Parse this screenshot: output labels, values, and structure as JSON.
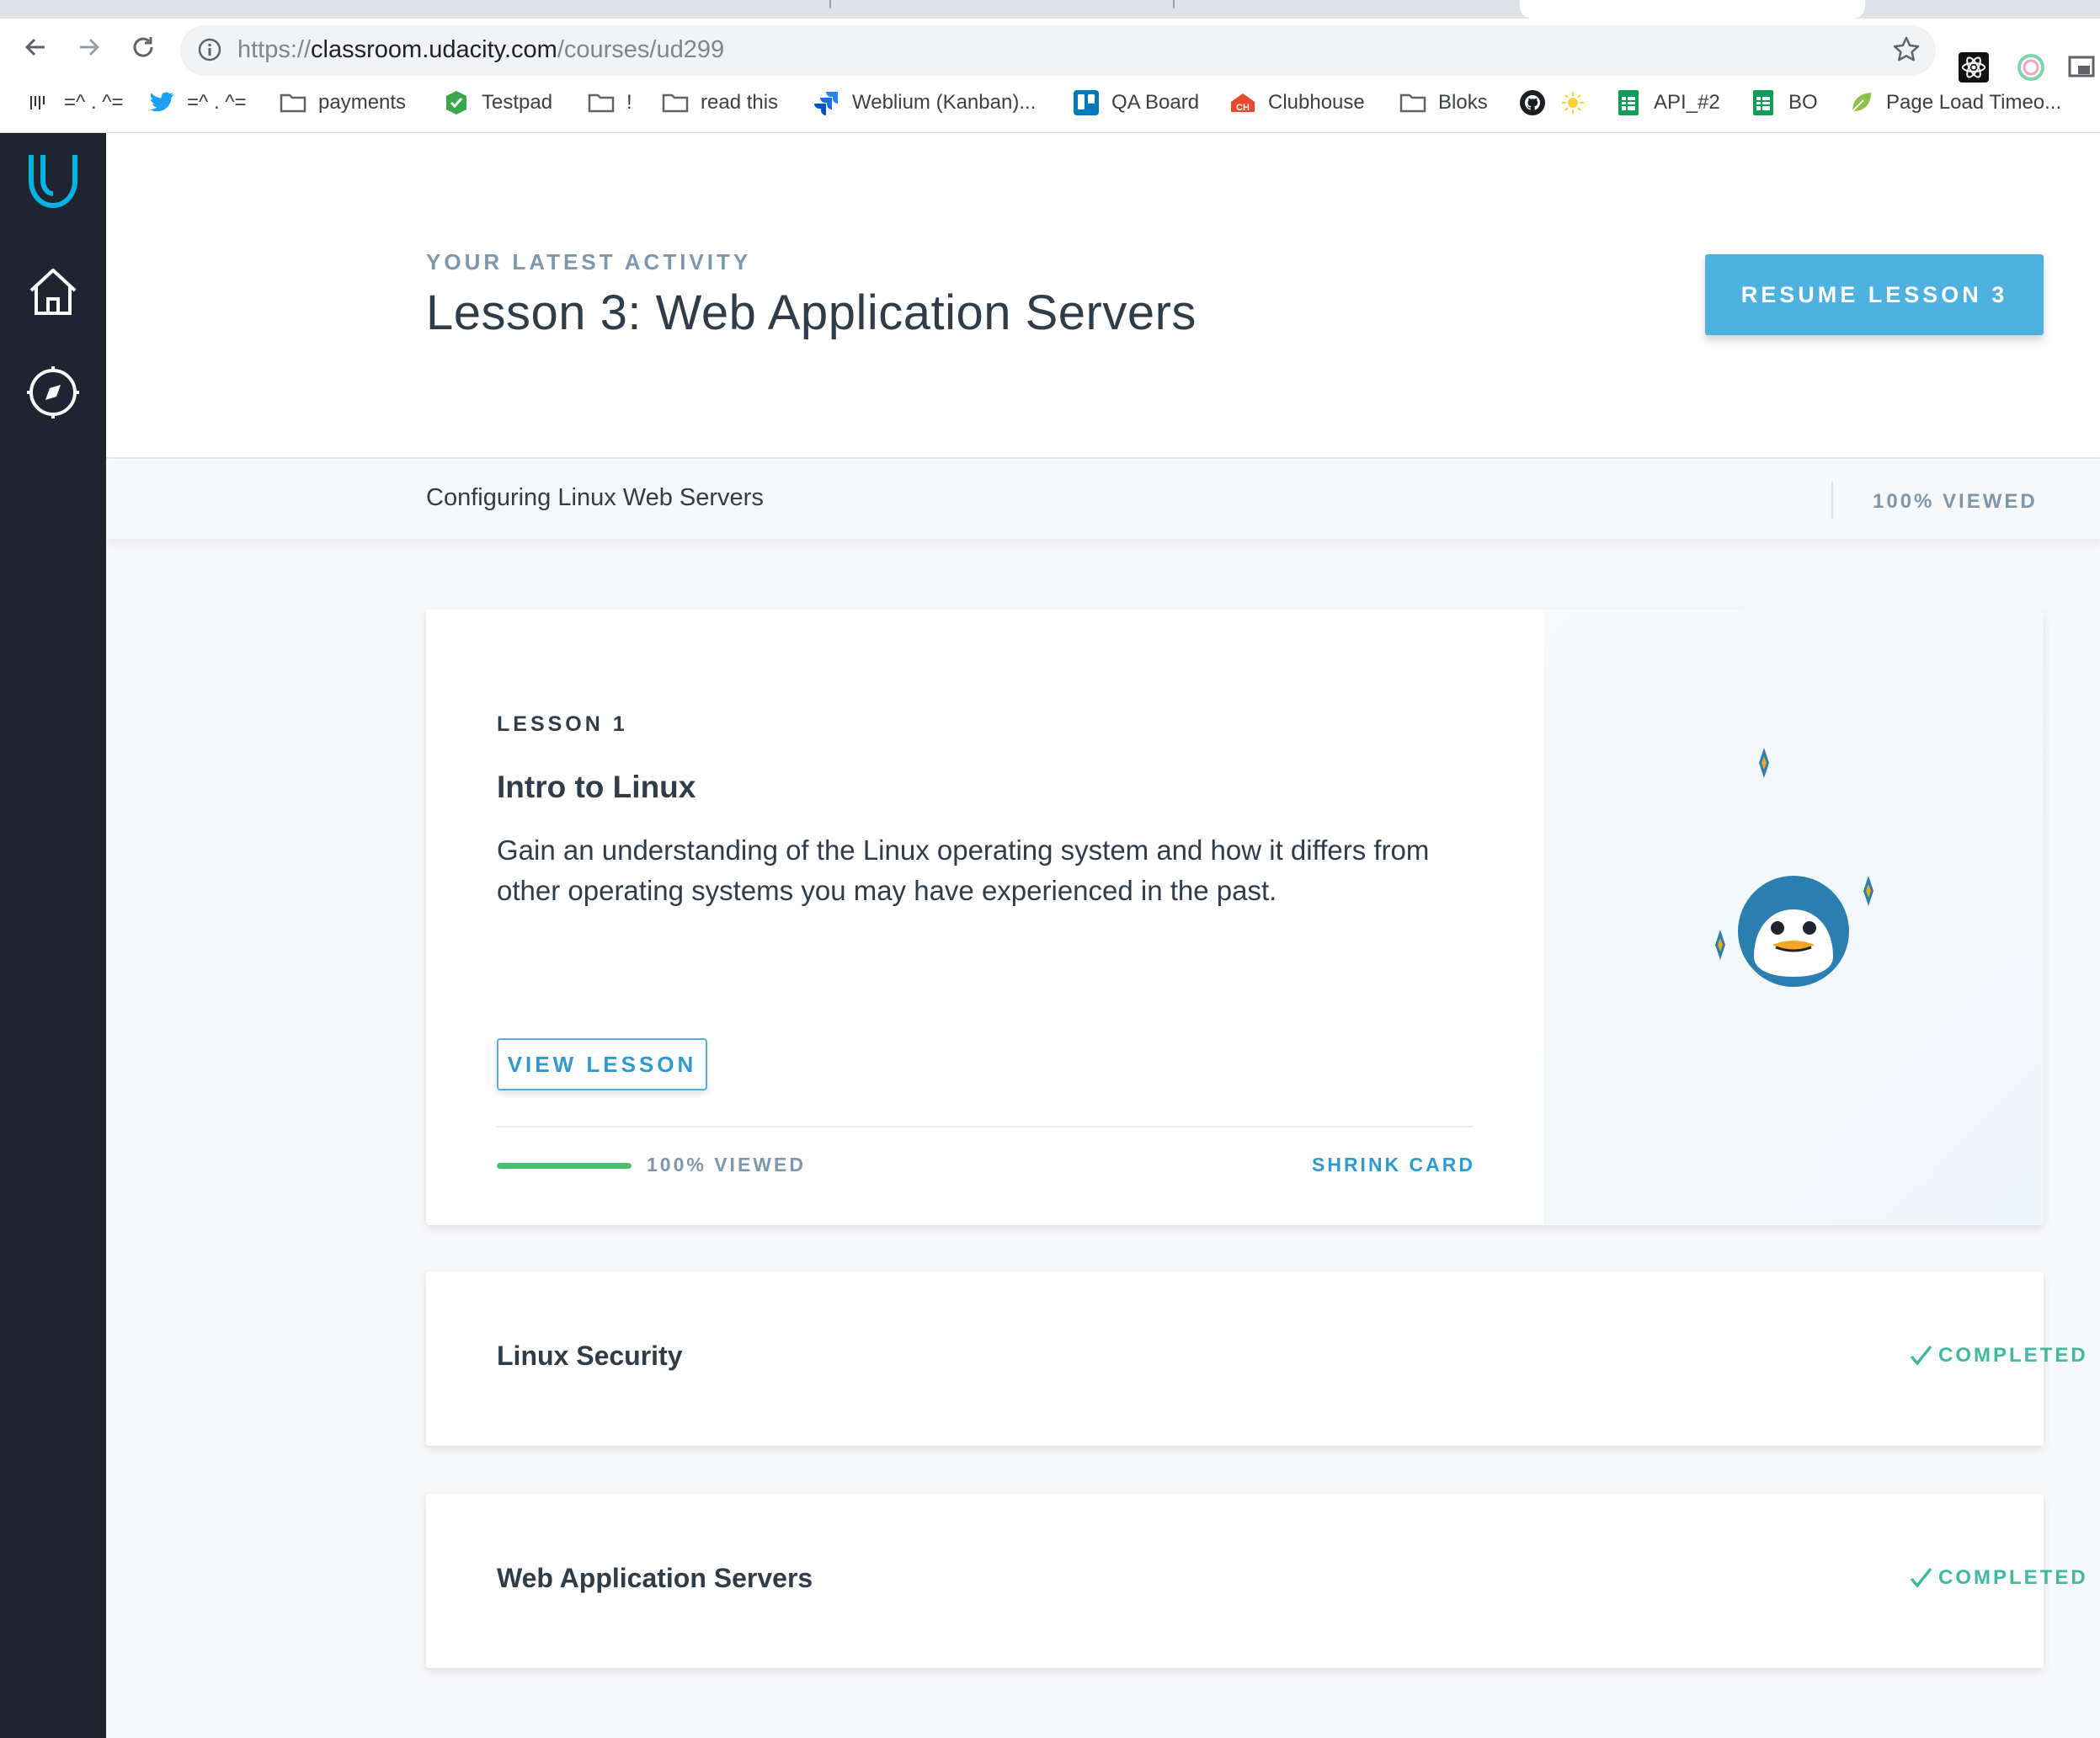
{
  "browser": {
    "url_scheme": "https://",
    "url_host": "classroom.udacity.com",
    "url_path": "/courses/ud299",
    "bookmarks": [
      {
        "label": "=^ . ^=",
        "icon": "bars-icon"
      },
      {
        "label": "=^ . ^=",
        "icon": "twitter-icon"
      },
      {
        "label": "payments",
        "icon": "folder-icon"
      },
      {
        "label": "Testpad",
        "icon": "testpad-icon"
      },
      {
        "label": "!",
        "icon": "folder-icon"
      },
      {
        "label": "read this",
        "icon": "folder-icon"
      },
      {
        "label": "Weblium (Kanban)...",
        "icon": "jira-icon"
      },
      {
        "label": "QA Board",
        "icon": "trello-icon"
      },
      {
        "label": "Clubhouse",
        "icon": "clubhouse-icon"
      },
      {
        "label": "Bloks",
        "icon": "folder-icon"
      },
      {
        "label": "",
        "icon": "github-icon"
      },
      {
        "label": "",
        "icon": "sun-icon"
      },
      {
        "label": "API_#2",
        "icon": "sheets-icon"
      },
      {
        "label": "BO",
        "icon": "sheets-icon"
      },
      {
        "label": "Page Load Timeo...",
        "icon": "leaf-icon"
      }
    ]
  },
  "hero": {
    "eyebrow": "YOUR LATEST ACTIVITY",
    "title": "Lesson 3: Web Application Servers",
    "resume_label": "RESUME LESSON 3"
  },
  "subbar": {
    "course_title": "Configuring Linux Web Servers",
    "viewed": "100% VIEWED"
  },
  "lessons": [
    {
      "label": "LESSON 1",
      "title": "Intro to Linux",
      "description": "Gain an understanding of the Linux operating system and how it differs from other operating systems you may have experienced in the past.",
      "button": "VIEW LESSON",
      "progress": 1.0,
      "progress_text": "100% VIEWED",
      "shrink": "SHRINK CARD"
    },
    {
      "title": "Linux Security",
      "status": "COMPLETED"
    },
    {
      "title": "Web Application Servers",
      "status": "COMPLETED"
    }
  ],
  "colors": {
    "sidebar": "#1f2530",
    "accent": "#4eb2e0",
    "progress": "#4bbf6b",
    "completed": "#41b8a0",
    "penguin": "#2b7fb0"
  }
}
